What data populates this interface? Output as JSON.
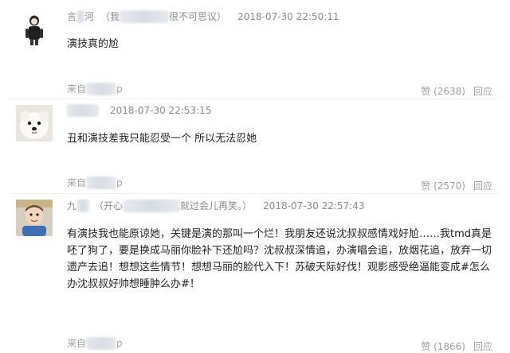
{
  "comments": [
    {
      "author_prefix": "言",
      "author_suffix": "河",
      "signature_prefix": "（我",
      "signature_suffix": "很不可思议）",
      "timestamp": "2018-07-30 22:50:11",
      "text": "演技真的尬",
      "source_prefix": "来自",
      "source_suffix": "p",
      "likes": "赞 (2638)",
      "reply": "回应"
    },
    {
      "author_prefix": "",
      "author_suffix": "",
      "signature_prefix": "",
      "signature_suffix": "",
      "timestamp": "2018-07-30 22:53:15",
      "text": "丑和演技差我只能忍受一个 所以无法忍她",
      "source_prefix": "来自",
      "source_suffix": "p",
      "likes": "赞 (2570)",
      "reply": "回应"
    },
    {
      "author_prefix": "九",
      "author_suffix": "",
      "signature_prefix": "（开心",
      "signature_suffix": "就过会儿再笑。）",
      "timestamp": "2018-07-30 22:57:43",
      "text": "有演技我也能原谅她，关键是演的那叫一个烂！我朋友还说沈叔叔感情戏好尬……我tmd真是呸了狗了，要是换成马丽你脸补下还尬吗？沈叔叔深情追，办演唱会追，放烟花追，放弃一切遗产去追！想想这些情节！想想马丽的脸代入下！苏破天际好伐！观影感受绝逼能变成#怎么办沈叔叔好帅想睡肿么办#！",
      "source_prefix": "来自",
      "source_suffix": "p",
      "likes": "赞 (1866)",
      "reply": "回应"
    }
  ]
}
